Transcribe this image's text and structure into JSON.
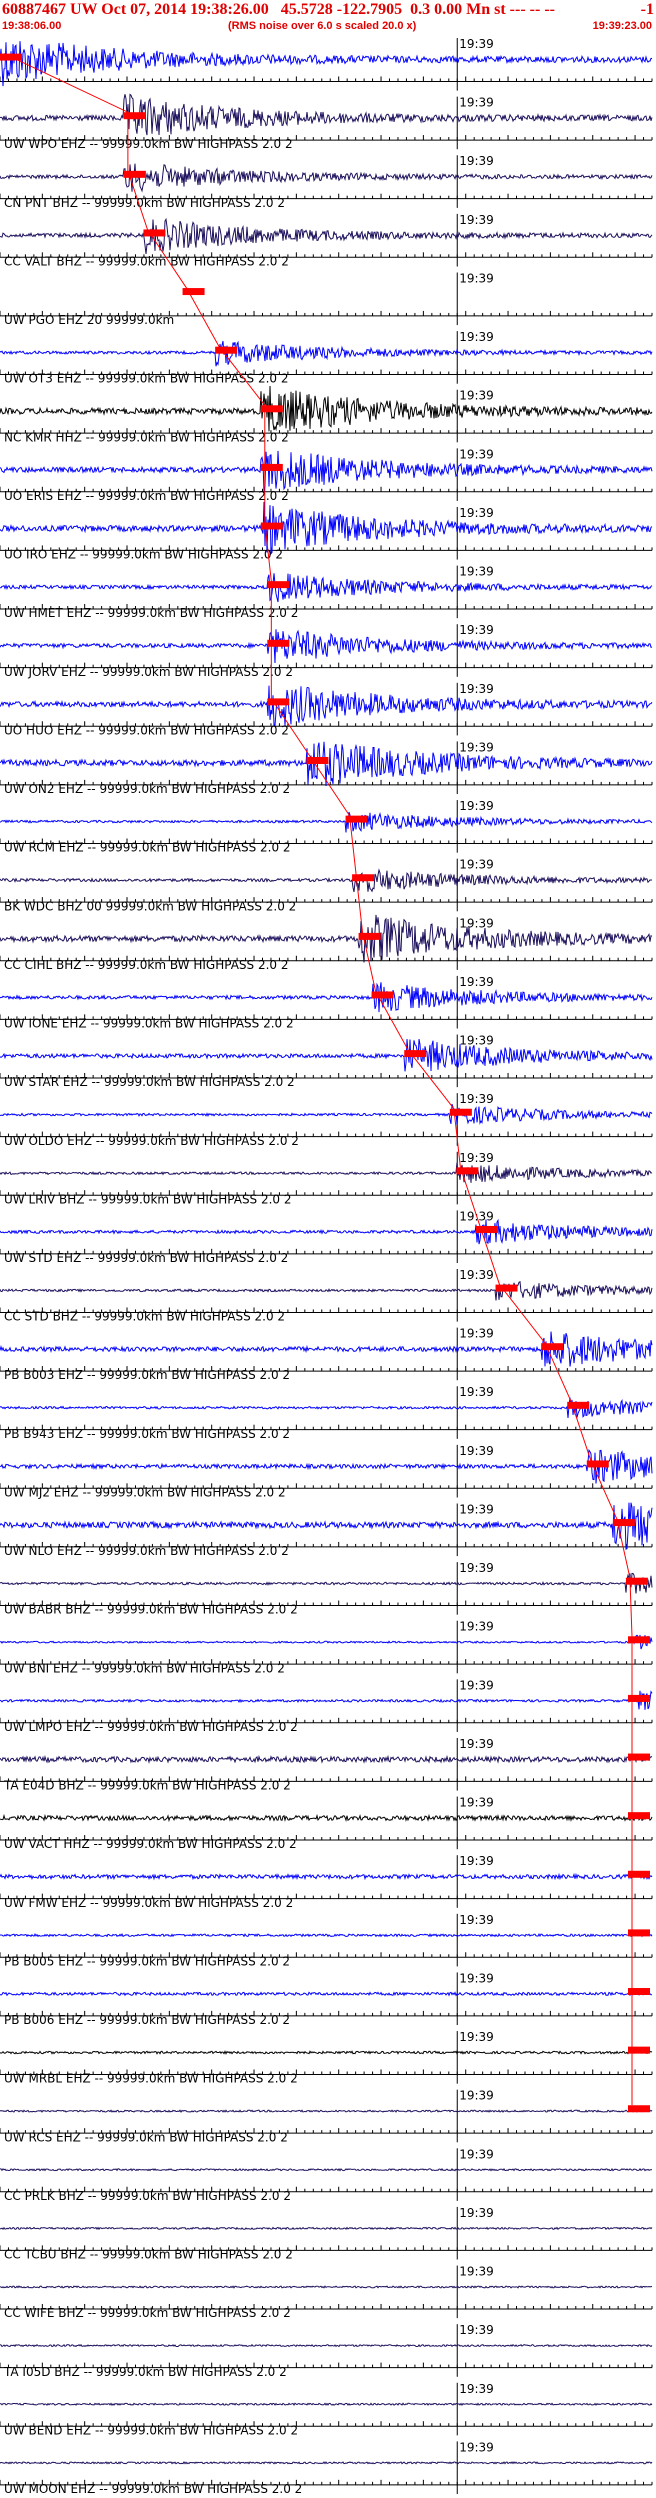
{
  "header": {
    "title": "60887467 UW Oct 07, 2014 19:38:26.00   45.5728 -122.7905  0.3 0.00 Mn st --- -- --",
    "event_num": "-1",
    "start_time": "19:38:06.00",
    "scaling_note": "(RMS noise over 6.0 s scaled 20.0 x)",
    "end_time": "19:39:23.00"
  },
  "chart_data": {
    "type": "line",
    "x_range": [
      "19:38:06.00",
      "19:39:23.00"
    ],
    "tick_label": "19:39",
    "colors": {
      "red": "#ff0000",
      "blue": "#0000ff",
      "navy": "#1c0f5c",
      "black": "#000000"
    },
    "traces": [
      {
        "label": "",
        "color": "blue",
        "pick": 0.0,
        "amp": 1.0
      },
      {
        "label": "UW WPO EHZ -- 99999.0km BW  HIGHPASS  2.0  2",
        "color": "navy",
        "pick": 0.19,
        "amp": 0.9
      },
      {
        "label": "CN PNT BHZ -- 99999.0km BW  HIGHPASS  2.0  2",
        "color": "navy",
        "pick": 0.19,
        "amp": 0.6
      },
      {
        "label": "CC VALT BHZ -- 99999.0km BW  HIGHPASS  2.0  2",
        "color": "navy",
        "pick": 0.22,
        "amp": 0.7
      },
      {
        "label": "UW PGO EHZ 20 99999.0km",
        "color": "blue",
        "pick": 0.28,
        "amp": 0.0
      },
      {
        "label": "UW OT3 EHZ -- 99999.0km BW  HIGHPASS  2.0  2",
        "color": "blue",
        "pick": 0.33,
        "amp": 0.5
      },
      {
        "label": "NC KMR HHZ -- 99999.0km BW  HIGHPASS  2.0  2",
        "color": "black",
        "pick": 0.4,
        "amp": 1.0
      },
      {
        "label": "UO ERIS EHZ -- 99999.0km BW  HIGHPASS  2.0  2",
        "color": "blue",
        "pick": 0.4,
        "amp": 0.9
      },
      {
        "label": "UO IRO EHZ -- 99999.0km BW  HIGHPASS  2.0  2",
        "color": "blue",
        "pick": 0.4,
        "amp": 1.0
      },
      {
        "label": "UW HMET EHZ -- 99999.0km BW  HIGHPASS  2.0  2",
        "color": "blue",
        "pick": 0.41,
        "amp": 0.6
      },
      {
        "label": "UW JORV EHZ -- 99999.0km BW  HIGHPASS  2.0  2",
        "color": "blue",
        "pick": 0.41,
        "amp": 0.7
      },
      {
        "label": "UO HUO EHZ -- 99999.0km BW  HIGHPASS  2.0  2",
        "color": "blue",
        "pick": 0.41,
        "amp": 0.9
      },
      {
        "label": "UW ON2 EHZ -- 99999.0km BW  HIGHPASS  2.0  2",
        "color": "blue",
        "pick": 0.47,
        "amp": 1.0
      },
      {
        "label": "UW RCM EHZ -- 99999.0km BW  HIGHPASS  2.0  2",
        "color": "blue",
        "pick": 0.53,
        "amp": 0.4
      },
      {
        "label": "BK WDC BHZ 00 99999.0km BW  HIGHPASS  2.0  2",
        "color": "navy",
        "pick": 0.54,
        "amp": 0.5
      },
      {
        "label": "CC CIHL BHZ -- 99999.0km BW  HIGHPASS  2.0  2",
        "color": "navy",
        "pick": 0.55,
        "amp": 1.0
      },
      {
        "label": "UW IONE EHZ -- 99999.0km BW  HIGHPASS  2.0  2",
        "color": "blue",
        "pick": 0.57,
        "amp": 0.6
      },
      {
        "label": "UW STAR EHZ -- 99999.0km BW  HIGHPASS  2.0  2",
        "color": "blue",
        "pick": 0.62,
        "amp": 0.7
      },
      {
        "label": "UW OLDO EHZ -- 99999.0km BW  HIGHPASS  2.0  2",
        "color": "blue",
        "pick": 0.69,
        "amp": 0.4
      },
      {
        "label": "UW LRIV BHZ -- 99999.0km BW  HIGHPASS  2.0  2",
        "color": "navy",
        "pick": 0.7,
        "amp": 0.4
      },
      {
        "label": "UW STD EHZ -- 99999.0km BW  HIGHPASS  2.0  2",
        "color": "blue",
        "pick": 0.73,
        "amp": 0.5
      },
      {
        "label": "CC STD BHZ -- 99999.0km BW  HIGHPASS  2.0  2",
        "color": "navy",
        "pick": 0.76,
        "amp": 0.4
      },
      {
        "label": "PB B003 EHZ -- 99999.0km BW  HIGHPASS  2.0  2",
        "color": "blue",
        "pick": 0.83,
        "amp": 0.8
      },
      {
        "label": "PB B943 EHZ -- 99999.0km BW  HIGHPASS  2.0  2",
        "color": "blue",
        "pick": 0.87,
        "amp": 0.4
      },
      {
        "label": "UW MJ2 EHZ -- 99999.0km BW  HIGHPASS  2.0  2",
        "color": "blue",
        "pick": 0.9,
        "amp": 0.7
      },
      {
        "label": "UW NLO EHZ -- 99999.0km BW  HIGHPASS  2.0  2",
        "color": "blue",
        "pick": 0.94,
        "amp": 1.0
      },
      {
        "label": "UW BABR BHZ -- 99999.0km BW  HIGHPASS  2.0  2",
        "color": "navy",
        "pick": 0.96,
        "amp": 0.4
      },
      {
        "label": "UW BNI EHZ -- 99999.0km BW  HIGHPASS  2.0  2",
        "color": "blue",
        "pick": 0.97,
        "amp": 0.3
      },
      {
        "label": "UW LMPO EHZ -- 99999.0km BW  HIGHPASS  2.0  2",
        "color": "blue",
        "pick": 0.98,
        "amp": 0.4
      },
      {
        "label": "TA E04D BHZ -- 99999.0km BW  HIGHPASS  2.0  2",
        "color": "navy",
        "pick": 1.02,
        "amp": 0.9
      },
      {
        "label": "UW VACT HHZ -- 99999.0km BW  HIGHPASS  2.0  2",
        "color": "black",
        "pick": 1.06,
        "amp": 0.8
      },
      {
        "label": "UW FMW EHZ -- 99999.0km BW  HIGHPASS  2.0  2",
        "color": "blue",
        "pick": 1.1,
        "amp": 0.7
      },
      {
        "label": "PB B005 EHZ -- 99999.0km BW  HIGHPASS  2.0  2",
        "color": "blue",
        "pick": 1.21,
        "amp": 0.4
      },
      {
        "label": "PB B006 EHZ -- 99999.0km BW  HIGHPASS  2.0  2",
        "color": "blue",
        "pick": 1.23,
        "amp": 0.5
      },
      {
        "label": "UW MRBL EHZ -- 99999.0km BW  HIGHPASS  2.0  2",
        "color": "black",
        "pick": 1.25,
        "amp": 0.4
      },
      {
        "label": "UW RCS EHZ -- 99999.0km BW  HIGHPASS  2.0  2",
        "color": "navy",
        "pick": 1.28,
        "amp": 0.3
      },
      {
        "label": "CC PRLK BHZ -- 99999.0km BW  HIGHPASS  2.0  2",
        "color": "navy",
        "pick": null,
        "amp": 0.3
      },
      {
        "label": "CC TCBU BHZ -- 99999.0km BW  HIGHPASS  2.0  2",
        "color": "navy",
        "pick": null,
        "amp": 0.3
      },
      {
        "label": "CC WIFE BHZ -- 99999.0km BW  HIGHPASS  2.0  2",
        "color": "navy",
        "pick": null,
        "amp": 0.3
      },
      {
        "label": "TA I05D BHZ -- 99999.0km BW  HIGHPASS  2.0  2",
        "color": "navy",
        "pick": null,
        "amp": 0.3
      },
      {
        "label": "UW BEND EHZ -- 99999.0km BW  HIGHPASS  2.0  2",
        "color": "navy",
        "pick": null,
        "amp": 0.3
      },
      {
        "label": "UW MOON EHZ -- 99999.0km BW  HIGHPASS  2.0  2",
        "color": "navy",
        "pick": null,
        "amp": 0.3
      }
    ]
  }
}
